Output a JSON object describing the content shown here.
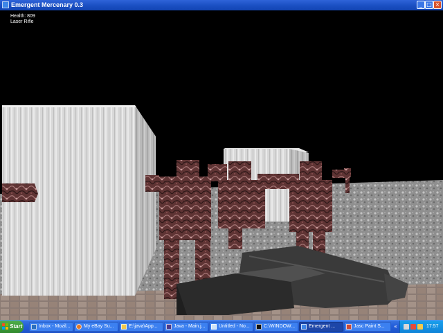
{
  "window": {
    "title": "Emergent Mercenary 0.3",
    "controls": {
      "minimize": "_",
      "maximize": "□",
      "close": "×"
    }
  },
  "hud": {
    "health": "Health: 809",
    "weapon": "Laser Rifle"
  },
  "taskbar": {
    "start_label": "Start",
    "items": [
      {
        "label": "Inbox - Mozil...",
        "icon": "mozilla-mail-icon",
        "active": false
      },
      {
        "label": "My eBay Su...",
        "icon": "firefox-icon",
        "active": false
      },
      {
        "label": "E:\\java\\App...",
        "icon": "folder-icon",
        "active": false
      },
      {
        "label": "Java - Main.j...",
        "icon": "eclipse-icon",
        "active": false
      },
      {
        "label": "Untitled - No...",
        "icon": "notepad-icon",
        "active": false
      },
      {
        "label": "C:\\WINDOW...",
        "icon": "cmd-icon",
        "active": false
      },
      {
        "label": "Emergent ...",
        "icon": "java-icon",
        "active": true
      },
      {
        "label": "Jasc Paint S...",
        "icon": "paint-shop-icon",
        "active": false
      }
    ],
    "overflow_label": "«",
    "clock": "17:57"
  },
  "colors": {
    "titlebar": "#1a4fc2",
    "taskbar": "#245edb",
    "start_button": "#318a2e",
    "tray": "#0f83d8",
    "sky": "#000000",
    "building": "#d6d6d6",
    "ground": "#9a9a9a",
    "zombie_skin": "#6e3c3c",
    "gun": "#333333"
  }
}
